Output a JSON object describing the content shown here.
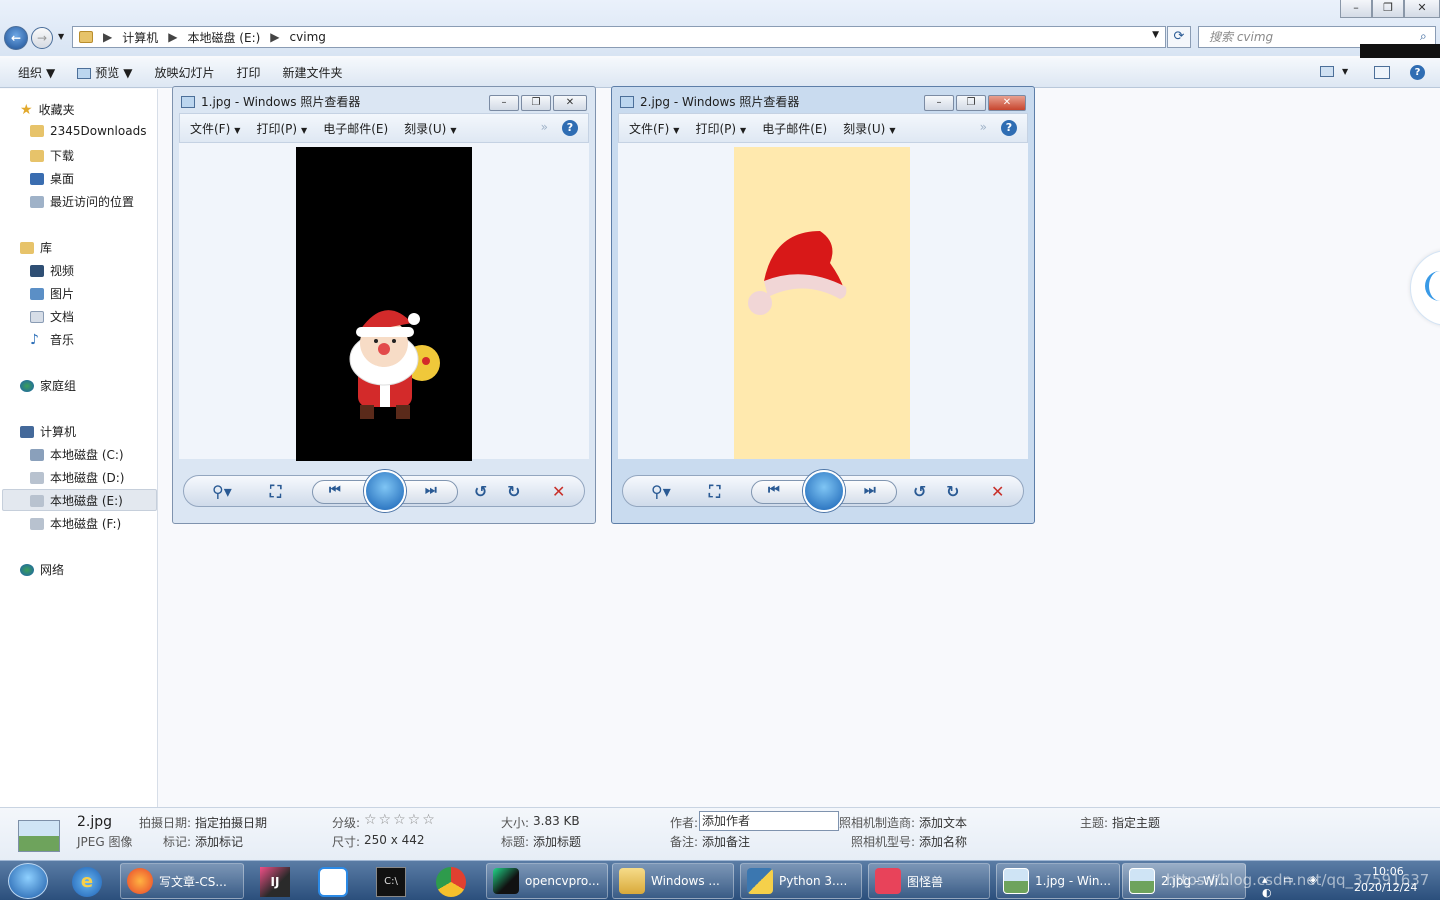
{
  "explorer": {
    "breadcrumb": [
      "计算机",
      "本地磁盘 (E:)",
      "cvimg"
    ],
    "search_placeholder": "搜索 cvimg",
    "toolbar": {
      "organize": "组织",
      "preview": "预览",
      "slideshow": "放映幻灯片",
      "print": "打印",
      "new_folder": "新建文件夹"
    },
    "sidebar": {
      "favorites": "收藏夹",
      "fav_items": [
        "2345Downloads",
        "下载",
        "桌面",
        "最近访问的位置"
      ],
      "library": "库",
      "lib_items": [
        "视频",
        "图片",
        "文档",
        "音乐"
      ],
      "homegroup": "家庭组",
      "computer": "计算机",
      "drives": [
        "本地磁盘 (C:)",
        "本地磁盘 (D:)",
        "本地磁盘 (E:)",
        "本地磁盘 (F:)"
      ],
      "network": "网络"
    }
  },
  "viewers": [
    {
      "title": "1.jpg - Windows 照片查看器",
      "menu": [
        "文件(F)",
        "打印(P)",
        "电子邮件(E)",
        "刻录(U)"
      ]
    },
    {
      "title": "2.jpg - Windows 照片查看器",
      "menu": [
        "文件(F)",
        "打印(P)",
        "电子邮件(E)",
        "刻录(U)"
      ]
    }
  ],
  "details": {
    "filename": "2.jpg",
    "filetype": "JPEG 图像",
    "date_label": "拍摄日期:",
    "date_value": "指定拍摄日期",
    "tags_label": "标记:",
    "tags_value": "添加标记",
    "rating_label": "分级:",
    "rating_stars": "☆☆☆☆☆",
    "dims_label": "尺寸:",
    "dims_value": "250 x 442",
    "size_label": "大小:",
    "size_value": "3.83 KB",
    "title_label": "标题:",
    "title_value": "添加标题",
    "author_label": "作者:",
    "author_value": "添加作者",
    "comment_label": "备注:",
    "comment_value": "添加备注",
    "maker_label": "照相机制造商:",
    "maker_value": "添加文本",
    "model_label": "照相机型号:",
    "model_value": "添加名称",
    "subject_label": "主题:",
    "subject_value": "指定主题"
  },
  "taskbar": {
    "items": [
      "写文章-CS...",
      "opencvpro...",
      "Windows ...",
      "Python 3....",
      "图怪兽",
      "1.jpg - Win...",
      "2.jpg - Wi..."
    ],
    "watermark": "https://blog.csdn.net/qq_37591637",
    "time": "10:06",
    "date": "2020/12/24"
  }
}
